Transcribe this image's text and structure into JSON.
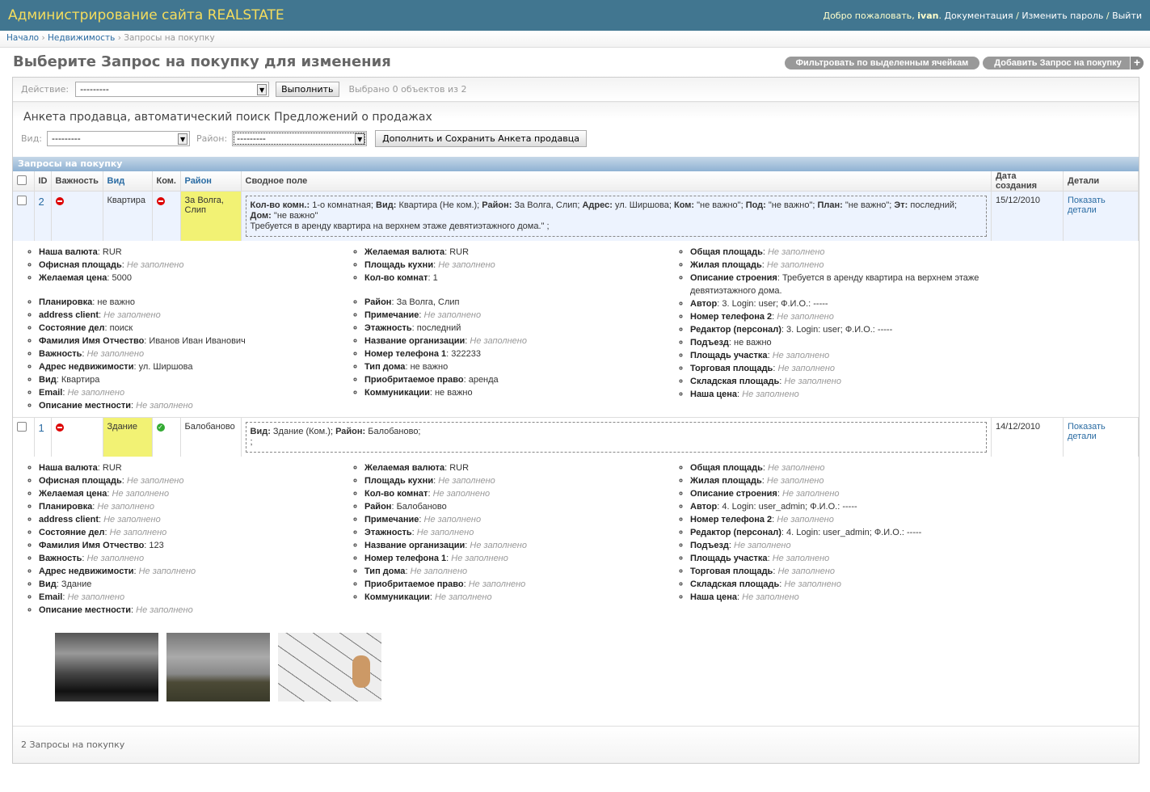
{
  "header": {
    "title": "Администрирование сайта REALSTATE",
    "welcome": "Добро пожаловать,",
    "user": "ivan",
    "docs": "Документация",
    "change_password": "Изменить пароль",
    "logout": "Выйти",
    "sep": "/"
  },
  "breadcrumbs": {
    "home": "Начало",
    "app": "Недвижимость",
    "current": "Запросы на покупку",
    "sep": "›"
  },
  "page_title": "Выберите Запрос на покупку для изменения",
  "tools": {
    "filter": "Фильтровать по выделенным ячейкам",
    "add": "Добавить Запрос на покупку",
    "add_icon": "+"
  },
  "actions": {
    "label": "Действие:",
    "value": "---------",
    "run": "Выполнить",
    "counter": "Выбрано 0 объектов из 2"
  },
  "seller": {
    "title": "Анкета продавца, автоматический поиск Предложений о продажах",
    "vid_label": "Вид:",
    "vid_value": "---------",
    "rayon_label": "Район:",
    "rayon_value": "---------",
    "save": "Дополнить и Сохранить Анкета продавца"
  },
  "caption": "Запросы на покупку",
  "columns": {
    "id": "ID",
    "importance": "Важность",
    "vid": "Вид",
    "kom": "Ком.",
    "rayon": "Район",
    "summary": "Сводное поле",
    "created": "Дата создания",
    "details": "Детали"
  },
  "rows": [
    {
      "id": "2",
      "importance": "no",
      "vid": "Квартира",
      "kom": "no",
      "rayon": "За Волга, Слип",
      "summary": [
        {
          "k": "Кол-во комн.:",
          "v": " 1-о комнатная; "
        },
        {
          "k": "Вид:",
          "v": " Квартира (Не ком.); "
        },
        {
          "k": "Район:",
          "v": " За Волга, Слип; "
        },
        {
          "k": "Адрес:",
          "v": " ул. Ширшова; "
        },
        {
          "k": "Ком:",
          "v": " \"не важно\"; "
        },
        {
          "k": "Под:",
          "v": " \"не важно\"; "
        },
        {
          "k": "План:",
          "v": " \"не важно\"; "
        },
        {
          "k": "Эт:",
          "v": " последний;"
        },
        {
          "k": "Дом:",
          "v": " \"не важно\"",
          "br": true
        },
        {
          "k": "",
          "v": "Требуется в аренду квартира на верхнем этаже девятиэтажного дома.\" ;",
          "br": true
        }
      ],
      "created": "15/12/2010",
      "details_link": "Показать детали",
      "detail_cols": [
        [
          {
            "k": "Наша валюта",
            "v": "RUR"
          },
          {
            "k": "Офисная площадь",
            "v": "Не заполнено",
            "e": true
          },
          {
            "k": "Желаемая цена",
            "v": "5000"
          },
          {
            "gap": true
          },
          {
            "k": "Планировка",
            "v": "не важно"
          },
          {
            "k": "address client",
            "v": "Не заполнено",
            "e": true
          },
          {
            "k": "Состояние дел",
            "v": "поиск"
          },
          {
            "k": "Фамилия Имя Отчество",
            "v": "Иванов Иван Иванович"
          },
          {
            "k": "Важность",
            "v": "Не заполнено",
            "e": true
          },
          {
            "k": "Адрес недвижимости",
            "v": "ул. Ширшова"
          },
          {
            "k": "Вид",
            "v": "Квартира"
          },
          {
            "k": "Email",
            "v": "Не заполнено",
            "e": true
          },
          {
            "k": "Описание местности",
            "v": "Не заполнено",
            "e": true
          }
        ],
        [
          {
            "k": "Желаемая валюта",
            "v": "RUR"
          },
          {
            "k": "Площадь кухни",
            "v": "Не заполнено",
            "e": true
          },
          {
            "k": "Кол-во комнат",
            "v": "1"
          },
          {
            "gap": true
          },
          {
            "k": "Район",
            "v": "За Волга, Слип"
          },
          {
            "k": "Примечание",
            "v": "Не заполнено",
            "e": true
          },
          {
            "k": "Этажность",
            "v": "последний"
          },
          {
            "k": "Название организации",
            "v": "Не заполнено",
            "e": true
          },
          {
            "k": "Номер телефона 1",
            "v": "322233"
          },
          {
            "k": "Тип дома",
            "v": "не важно"
          },
          {
            "k": "Приобритаемое право",
            "v": "аренда"
          },
          {
            "k": "Коммуникации",
            "v": "не важно"
          }
        ],
        [
          {
            "k": "Общая площадь",
            "v": "Не заполнено",
            "e": true
          },
          {
            "k": "Жилая площадь",
            "v": "Не заполнено",
            "e": true
          },
          {
            "k": "Описание строения",
            "v": "Требуется в аренду квартира на верхнем этаже девятиэтажного дома."
          },
          {
            "k": "Автор",
            "v": "3. Login: user; Ф.И.О.: -----"
          },
          {
            "k": "Номер телефона 2",
            "v": "Не заполнено",
            "e": true
          },
          {
            "k": "Редактор (персонал)",
            "v": "3. Login: user; Ф.И.О.: -----"
          },
          {
            "k": "Подъезд",
            "v": "не важно"
          },
          {
            "k": "Площадь участка",
            "v": "Не заполнено",
            "e": true
          },
          {
            "k": "Торговая площадь",
            "v": "Не заполнено",
            "e": true
          },
          {
            "k": "Складская площадь",
            "v": "Не заполнено",
            "e": true
          },
          {
            "k": "Наша цена",
            "v": "Не заполнено",
            "e": true
          }
        ]
      ]
    },
    {
      "id": "1",
      "importance": "no",
      "vid": "Здание",
      "kom": "yes",
      "rayon": "Балобаново",
      "summary": [
        {
          "k": "Вид:",
          "v": " Здание (Ком.); "
        },
        {
          "k": "Район:",
          "v": " Балобаново;"
        },
        {
          "k": "",
          "v": ";",
          "br": true
        }
      ],
      "created": "14/12/2010",
      "details_link": "Показать детали",
      "detail_cols": [
        [
          {
            "k": "Наша валюта",
            "v": "RUR"
          },
          {
            "k": "Офисная площадь",
            "v": "Не заполнено",
            "e": true
          },
          {
            "k": "Желаемая цена",
            "v": "Не заполнено",
            "e": true
          },
          {
            "k": "Планировка",
            "v": "Не заполнено",
            "e": true
          },
          {
            "k": "address client",
            "v": "Не заполнено",
            "e": true
          },
          {
            "k": "Состояние дел",
            "v": "Не заполнено",
            "e": true
          },
          {
            "k": "Фамилия Имя Отчество",
            "v": "123"
          },
          {
            "k": "Важность",
            "v": "Не заполнено",
            "e": true
          },
          {
            "k": "Адрес недвижимости",
            "v": "Не заполнено",
            "e": true
          },
          {
            "k": "Вид",
            "v": "Здание"
          },
          {
            "k": "Email",
            "v": "Не заполнено",
            "e": true
          },
          {
            "k": "Описание местности",
            "v": "Не заполнено",
            "e": true
          }
        ],
        [
          {
            "k": "Желаемая валюта",
            "v": "RUR"
          },
          {
            "k": "Площадь кухни",
            "v": "Не заполнено",
            "e": true
          },
          {
            "k": "Кол-во комнат",
            "v": "Не заполнено",
            "e": true
          },
          {
            "k": "Район",
            "v": "Балобаново"
          },
          {
            "k": "Примечание",
            "v": "Не заполнено",
            "e": true
          },
          {
            "k": "Этажность",
            "v": "Не заполнено",
            "e": true
          },
          {
            "k": "Название организации",
            "v": "Не заполнено",
            "e": true
          },
          {
            "k": "Номер телефона 1",
            "v": "Не заполнено",
            "e": true
          },
          {
            "k": "Тип дома",
            "v": "Не заполнено",
            "e": true
          },
          {
            "k": "Приобритаемое право",
            "v": "Не заполнено",
            "e": true
          },
          {
            "k": "Коммуникации",
            "v": "Не заполнено",
            "e": true
          }
        ],
        [
          {
            "k": "Общая площадь",
            "v": "Не заполнено",
            "e": true
          },
          {
            "k": "Жилая площадь",
            "v": "Не заполнено",
            "e": true
          },
          {
            "k": "Описание строения",
            "v": "Не заполнено",
            "e": true
          },
          {
            "k": "Автор",
            "v": "4. Login: user_admin; Ф.И.О.: -----"
          },
          {
            "k": "Номер телефона 2",
            "v": "Не заполнено",
            "e": true
          },
          {
            "k": "Редактор (персонал)",
            "v": "4. Login: user_admin; Ф.И.О.: -----"
          },
          {
            "k": "Подъезд",
            "v": "Не заполнено",
            "e": true
          },
          {
            "k": "Площадь участка",
            "v": "Не заполнено",
            "e": true
          },
          {
            "k": "Торговая площадь",
            "v": "Не заполнено",
            "e": true
          },
          {
            "k": "Складская площадь",
            "v": "Не заполнено",
            "e": true
          },
          {
            "k": "Наша цена",
            "v": "Не заполнено",
            "e": true
          }
        ]
      ],
      "images": [
        "photo-storm-sky",
        "photo-field-sky",
        "photo-geodesic-dome"
      ]
    }
  ],
  "footer": "2 Запросы на покупку"
}
